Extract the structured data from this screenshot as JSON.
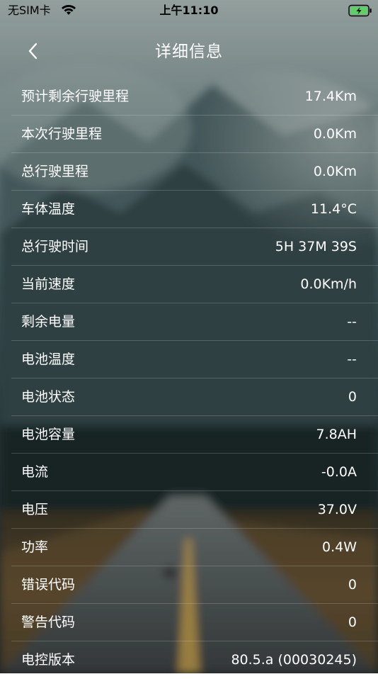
{
  "status_bar": {
    "carrier": "无SIM卡",
    "time": "上午11:10",
    "wifi_icon": "wifi-icon",
    "battery_icon": "battery-charging-icon"
  },
  "nav": {
    "title": "详细信息",
    "back_icon": "chevron-left-icon"
  },
  "rows": [
    {
      "label": "预计剩余行驶里程",
      "value": "17.4Km"
    },
    {
      "label": "本次行驶里程",
      "value": "0.0Km"
    },
    {
      "label": "总行驶里程",
      "value": "0.0Km"
    },
    {
      "label": "车体温度",
      "value": "11.4°C"
    },
    {
      "label": "总行驶时间",
      "value": "5H 37M 39S"
    },
    {
      "label": "当前速度",
      "value": "0.0Km/h"
    },
    {
      "label": "剩余电量",
      "value": "--"
    },
    {
      "label": "电池温度",
      "value": "--"
    },
    {
      "label": "电池状态",
      "value": "0"
    },
    {
      "label": "电池容量",
      "value": "7.8AH"
    },
    {
      "label": "电流",
      "value": "-0.0A"
    },
    {
      "label": "电压",
      "value": "37.0V"
    },
    {
      "label": "功率",
      "value": "0.4W"
    },
    {
      "label": "错误代码",
      "value": "0"
    },
    {
      "label": "警告代码",
      "value": "0"
    },
    {
      "label": "电控版本",
      "value": "80.5.a (00030245)"
    }
  ],
  "colors": {
    "battery_fill": "#5fd068",
    "text": "#ffffff"
  }
}
